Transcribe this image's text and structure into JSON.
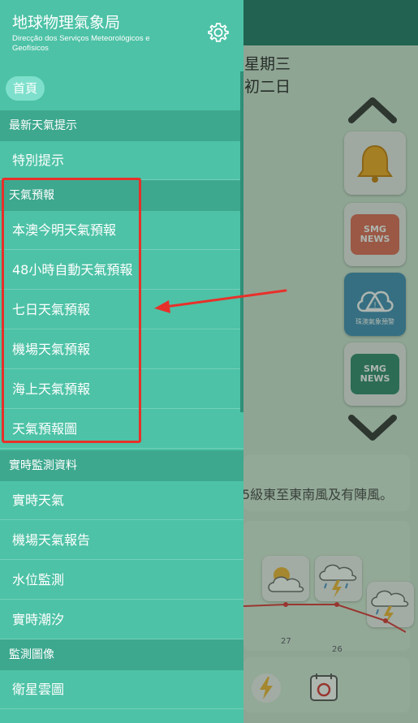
{
  "drawer": {
    "title": "地球物理氣象局",
    "subtitle": "Direcção dos Serviços Meteorológicos e Geofísicos",
    "home": "首頁",
    "sections": [
      {
        "header": "最新天氣提示",
        "items": [
          "特別提示"
        ]
      },
      {
        "header": "天氣預報",
        "items": [
          "本澳今明天氣預報",
          "48小時自動天氣預報",
          "七日天氣預報",
          "機場天氣預報",
          "海上天氣預報",
          "天氣預報圖"
        ]
      },
      {
        "header": "實時監測資料",
        "items": [
          "實時天氣",
          "機場天氣報告",
          "水位監測",
          "實時潮汐"
        ]
      },
      {
        "header": "監測圖像",
        "items": [
          "衛星雲圖"
        ]
      }
    ]
  },
  "background": {
    "date_line1": "星期三",
    "date_line2": "初二日",
    "tiles": [
      {
        "icon": "bell-icon"
      },
      {
        "icon": "smg-news-icon",
        "text": "SMG NEWS"
      },
      {
        "icon": "warning-cloud-icon",
        "label": "珠澳氣象預警"
      },
      {
        "icon": "smg-news-icon",
        "text": "SMG NEWS"
      }
    ],
    "wind_text": "5級東至東南風及有陣風。",
    "temps": [
      "27",
      "26"
    ]
  },
  "colors": {
    "drawer": "#4dc2a6",
    "section": "#3da88e",
    "highlight": "#e8302a"
  }
}
